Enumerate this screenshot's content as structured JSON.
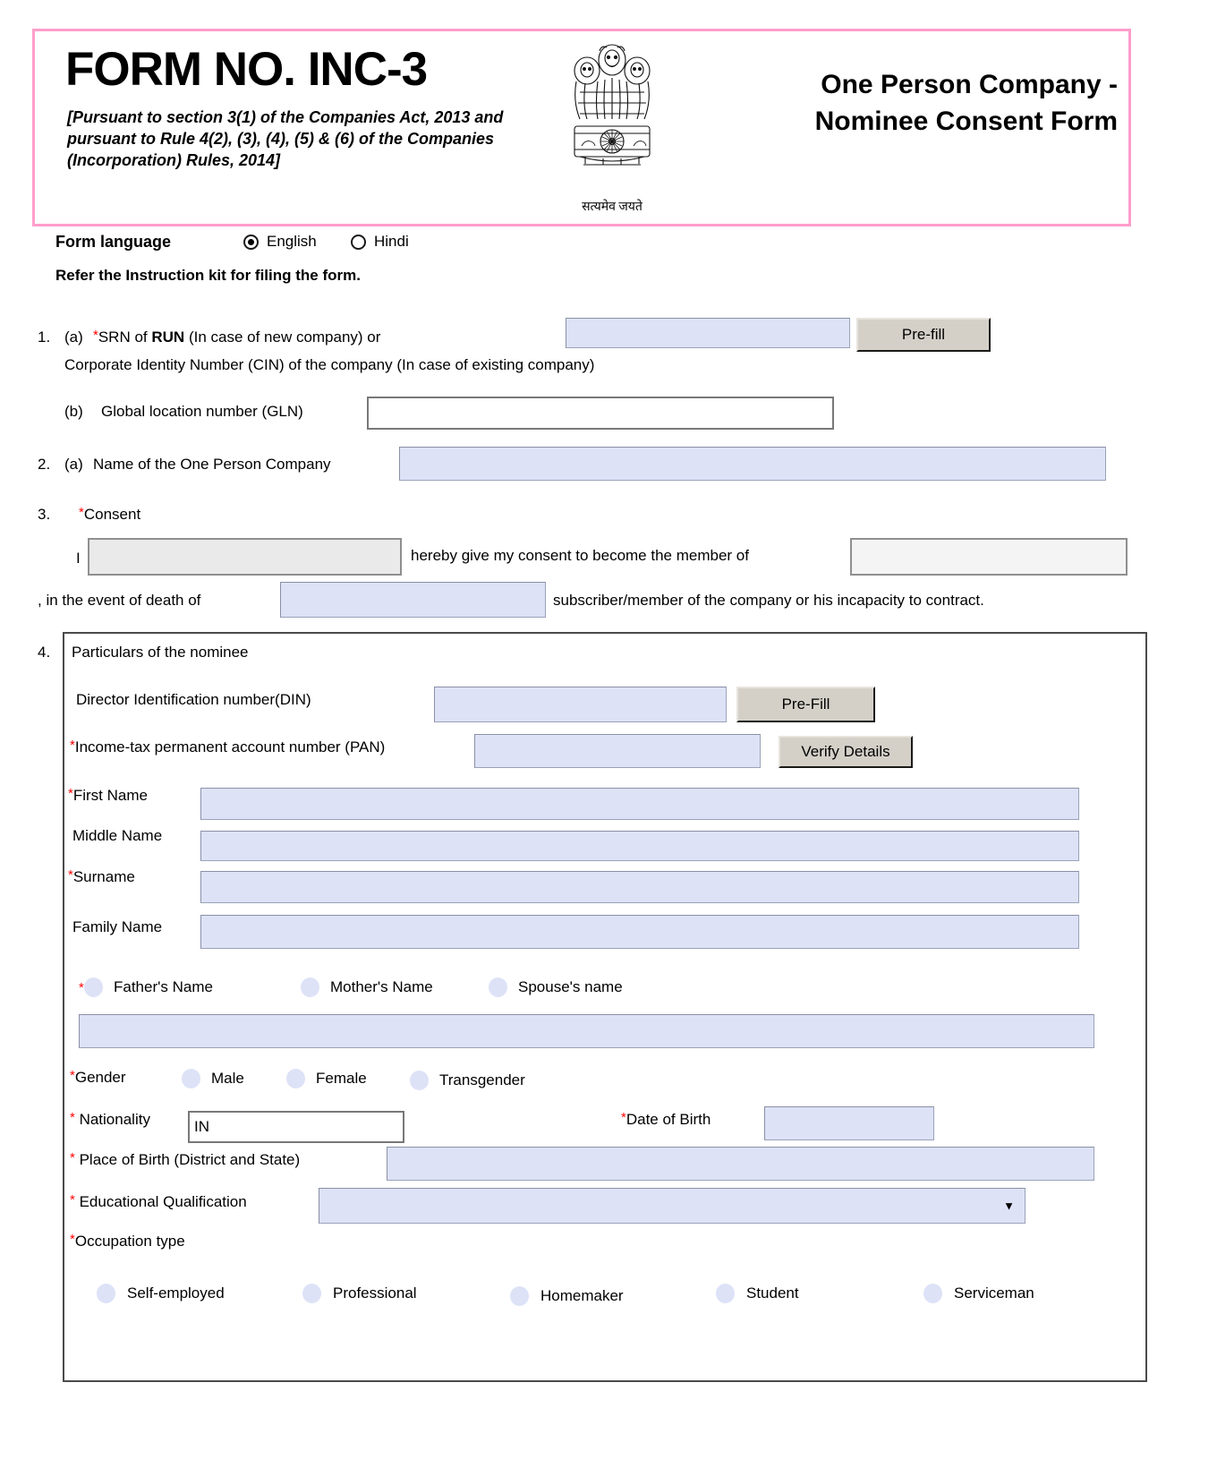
{
  "header": {
    "form_no": "FORM NO. INC-3",
    "pursuant": "[Pursuant to section 3(1) of the Companies Act, 2013 and pursuant to Rule 4(2), (3), (4), (5) & (6) of the Companies (Incorporation) Rules, 2014]",
    "right_title": "One Person Company - Nominee Consent Form",
    "emblem_motto": "सत्यमेव जयते",
    "border_color": "#ff9ecb"
  },
  "language": {
    "label": "Form language",
    "options": [
      "English",
      "Hindi"
    ],
    "selected": "English",
    "instruction": "Refer the Instruction kit for filing the form."
  },
  "item1": {
    "number": "1.",
    "a_label": "(a)",
    "a_text_1": "SRN of ",
    "a_text_bold": "RUN",
    "a_text_2": " (In case of new company) or",
    "a_text_line2": "Corporate Identity Number (CIN) of the company (In case of existing company)",
    "srn_value": "",
    "prefill_label": "Pre-fill",
    "b_label": "(b)",
    "b_text": "Global location number (GLN)",
    "gln_value": ""
  },
  "item2": {
    "number": "2.",
    "a_label": "(a)",
    "label": "Name of the One Person Company",
    "value": ""
  },
  "item3": {
    "number": "3.",
    "label": "Consent",
    "i_prefix": "I",
    "nominee_name_value": "",
    "mid_text": "hereby give my consent to become the member of",
    "company_value": "",
    "death_prefix": ", in the event of death of",
    "subscriber_value": "",
    "suffix_text": "subscriber/member of the company or his incapacity to contract."
  },
  "item4": {
    "number": "4.",
    "title": "Particulars of the nominee",
    "din_label": "Director Identification number(DIN)",
    "din_value": "",
    "din_prefill_label": "Pre-Fill",
    "pan_label": "Income-tax permanent account number (PAN)",
    "pan_value": "",
    "verify_label": "Verify Details",
    "names": [
      {
        "label": "First Name",
        "required": true,
        "value": ""
      },
      {
        "label": "Middle Name",
        "required": false,
        "value": ""
      },
      {
        "label": "Surname",
        "required": true,
        "value": ""
      },
      {
        "label": "Family Name",
        "required": false,
        "value": ""
      }
    ],
    "parent_options": [
      "Father's Name",
      "Mother's Name",
      "Spouse's name"
    ],
    "parent_name_value": "",
    "gender_label": "Gender",
    "gender_options": [
      "Male",
      "Female",
      "Transgender"
    ],
    "nationality_label": "Nationality",
    "nationality_value": "IN",
    "dob_label": "Date of Birth",
    "dob_value": "",
    "pob_label": "Place of Birth (District and State)",
    "pob_value": "",
    "edu_label": "Educational Qualification",
    "edu_value": "",
    "occupation_label": "Occupation type",
    "occupation_options": [
      "Self-employed",
      "Professional",
      "Homemaker",
      "Student",
      "Serviceman"
    ]
  }
}
